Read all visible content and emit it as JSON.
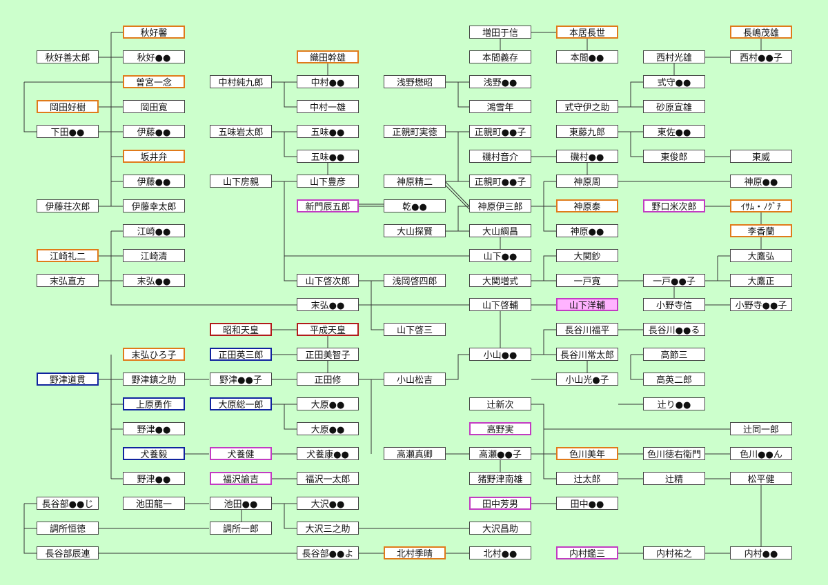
{
  "nodes": [
    {
      "id": "n1",
      "label": "秋好馨",
      "style": "orange"
    },
    {
      "id": "n2",
      "label": "秋好善太郎"
    },
    {
      "id": "n3",
      "label": "秋好●●"
    },
    {
      "id": "n4",
      "label": "曽宮一念",
      "style": "orange"
    },
    {
      "id": "n5",
      "label": "岡田好樹",
      "style": "orange"
    },
    {
      "id": "n6",
      "label": "岡田寛"
    },
    {
      "id": "n7",
      "label": "下田●●"
    },
    {
      "id": "n8",
      "label": "伊藤●●"
    },
    {
      "id": "n9",
      "label": "坂井弁",
      "style": "orange"
    },
    {
      "id": "n10",
      "label": "伊藤●●"
    },
    {
      "id": "n11",
      "label": "伊藤荘次郎"
    },
    {
      "id": "n12",
      "label": "伊藤幸太郎"
    },
    {
      "id": "n13",
      "label": "江崎●●"
    },
    {
      "id": "n14",
      "label": "江崎礼二",
      "style": "orange"
    },
    {
      "id": "n15",
      "label": "江崎清"
    },
    {
      "id": "n16",
      "label": "末弘直方"
    },
    {
      "id": "n17",
      "label": "末弘●●"
    },
    {
      "id": "n18",
      "label": "末弘ひろ子",
      "style": "orange"
    },
    {
      "id": "n19",
      "label": "野津道貫",
      "style": "navy"
    },
    {
      "id": "n20",
      "label": "野津鎮之助"
    },
    {
      "id": "n21",
      "label": "上原勇作",
      "style": "navy"
    },
    {
      "id": "n22",
      "label": "野津●●"
    },
    {
      "id": "n23",
      "label": "犬養毅",
      "style": "navy"
    },
    {
      "id": "n24",
      "label": "野津●●"
    },
    {
      "id": "n25",
      "label": "長谷部●●じ"
    },
    {
      "id": "n26",
      "label": "調所恒徳"
    },
    {
      "id": "n27",
      "label": "長谷部辰連"
    },
    {
      "id": "n28",
      "label": "池田龍一"
    },
    {
      "id": "n29",
      "label": "中村純九郎"
    },
    {
      "id": "n30",
      "label": "五味岩太郎"
    },
    {
      "id": "n31",
      "label": "山下房親"
    },
    {
      "id": "n32",
      "label": "昭和天皇",
      "style": "crimson"
    },
    {
      "id": "n33",
      "label": "正田英三郎",
      "style": "navy"
    },
    {
      "id": "n34",
      "label": "野津●●子"
    },
    {
      "id": "n35",
      "label": "大原総一郎",
      "style": "navy"
    },
    {
      "id": "n36",
      "label": "犬養健",
      "style": "magenta"
    },
    {
      "id": "n37",
      "label": "福沢諭吉",
      "style": "magenta"
    },
    {
      "id": "n38",
      "label": "池田●●"
    },
    {
      "id": "n39",
      "label": "調所一郎"
    },
    {
      "id": "n40",
      "label": "織田幹雄",
      "style": "orange"
    },
    {
      "id": "n41",
      "label": "中村●●"
    },
    {
      "id": "n42",
      "label": "中村一雄"
    },
    {
      "id": "n43",
      "label": "五味●●"
    },
    {
      "id": "n44",
      "label": "五味●●"
    },
    {
      "id": "n45",
      "label": "山下豊彦"
    },
    {
      "id": "n46",
      "label": "新門辰五郎",
      "style": "magenta"
    },
    {
      "id": "n47",
      "label": "山下啓次郎"
    },
    {
      "id": "n48",
      "label": "末弘●●"
    },
    {
      "id": "n49",
      "label": "平成天皇",
      "style": "crimson"
    },
    {
      "id": "n50",
      "label": "正田美智子"
    },
    {
      "id": "n51",
      "label": "正田修"
    },
    {
      "id": "n52",
      "label": "大原●●"
    },
    {
      "id": "n53",
      "label": "大原●●"
    },
    {
      "id": "n54",
      "label": "犬養康●●"
    },
    {
      "id": "n55",
      "label": "福沢一太郎"
    },
    {
      "id": "n56",
      "label": "大沢●●"
    },
    {
      "id": "n57",
      "label": "大沢三之助"
    },
    {
      "id": "n58",
      "label": "長谷部●●よ"
    },
    {
      "id": "n59",
      "label": "浅野懋昭"
    },
    {
      "id": "n60",
      "label": "正親町実徳"
    },
    {
      "id": "n61",
      "label": "神原精二"
    },
    {
      "id": "n62",
      "label": "乾●●"
    },
    {
      "id": "n63",
      "label": "大山探賢"
    },
    {
      "id": "n64",
      "label": "浅岡啓四郎"
    },
    {
      "id": "n65",
      "label": "山下啓三"
    },
    {
      "id": "n66",
      "label": "小山松吉"
    },
    {
      "id": "n67",
      "label": "高瀬真卿"
    },
    {
      "id": "n68",
      "label": "北村季晴",
      "style": "orange"
    },
    {
      "id": "n69",
      "label": "増田于信"
    },
    {
      "id": "n70",
      "label": "本間義存"
    },
    {
      "id": "n71",
      "label": "浅野●●"
    },
    {
      "id": "n72",
      "label": "鴻雪年"
    },
    {
      "id": "n73",
      "label": "正親町●●子"
    },
    {
      "id": "n74",
      "label": "磯村音介"
    },
    {
      "id": "n75",
      "label": "正親町●●子"
    },
    {
      "id": "n76",
      "label": "神原伊三郎"
    },
    {
      "id": "n77",
      "label": "大山綱昌"
    },
    {
      "id": "n78",
      "label": "山下●●"
    },
    {
      "id": "n79",
      "label": "大関増式"
    },
    {
      "id": "n80",
      "label": "山下啓輔"
    },
    {
      "id": "n81",
      "label": "小山●●"
    },
    {
      "id": "n82",
      "label": "辻新次"
    },
    {
      "id": "n83",
      "label": "高野実",
      "style": "magenta"
    },
    {
      "id": "n84",
      "label": "高瀬●●子"
    },
    {
      "id": "n85",
      "label": "猪野津南雄"
    },
    {
      "id": "n86",
      "label": "田中芳男",
      "style": "magenta"
    },
    {
      "id": "n87",
      "label": "大沢昌助"
    },
    {
      "id": "n88",
      "label": "北村●●"
    },
    {
      "id": "n89",
      "label": "本居長世",
      "style": "orange"
    },
    {
      "id": "n90",
      "label": "本間●●"
    },
    {
      "id": "n91",
      "label": "式守伊之助"
    },
    {
      "id": "n92",
      "label": "東藤九郎"
    },
    {
      "id": "n93",
      "label": "磯村●●"
    },
    {
      "id": "n94",
      "label": "神原周"
    },
    {
      "id": "n95",
      "label": "神原泰",
      "style": "orange"
    },
    {
      "id": "n96",
      "label": "神原●●"
    },
    {
      "id": "n97",
      "label": "大関鈔"
    },
    {
      "id": "n98",
      "label": "一戸寛"
    },
    {
      "id": "n99",
      "label": "山下洋輔",
      "style": "magenta pinkfill"
    },
    {
      "id": "n100",
      "label": "長谷川福平"
    },
    {
      "id": "n101",
      "label": "長谷川常太郎"
    },
    {
      "id": "n102",
      "label": "小山光●子"
    },
    {
      "id": "n103",
      "label": "色川美年",
      "style": "orange"
    },
    {
      "id": "n104",
      "label": "辻太郎"
    },
    {
      "id": "n105",
      "label": "田中●●"
    },
    {
      "id": "n106",
      "label": "内村鑑三",
      "style": "magenta"
    },
    {
      "id": "n107",
      "label": "西村光雄"
    },
    {
      "id": "n108",
      "label": "式守●●"
    },
    {
      "id": "n109",
      "label": "砂原宣雄"
    },
    {
      "id": "n110",
      "label": "東佐●●"
    },
    {
      "id": "n111",
      "label": "東俊郎"
    },
    {
      "id": "n112",
      "label": "野口米次郎",
      "style": "magenta"
    },
    {
      "id": "n113",
      "label": "一戸●●子"
    },
    {
      "id": "n114",
      "label": "小野寺信"
    },
    {
      "id": "n115",
      "label": "長谷川●●る"
    },
    {
      "id": "n116",
      "label": "高節三"
    },
    {
      "id": "n117",
      "label": "高英二郎"
    },
    {
      "id": "n118",
      "label": "辻り●●"
    },
    {
      "id": "n119",
      "label": "色川徳右衛門"
    },
    {
      "id": "n120",
      "label": "辻精"
    },
    {
      "id": "n121",
      "label": "内村祐之"
    },
    {
      "id": "n122",
      "label": "長嶋茂雄",
      "style": "orange"
    },
    {
      "id": "n123",
      "label": "西村●●子"
    },
    {
      "id": "n124",
      "label": "東威"
    },
    {
      "id": "n125",
      "label": "神原●●"
    },
    {
      "id": "n126",
      "label": "ｲｻﾑ・ﾉｸﾞﾁ",
      "style": "orange"
    },
    {
      "id": "n127",
      "label": "李香蘭",
      "style": "orange"
    },
    {
      "id": "n128",
      "label": "大鷹弘"
    },
    {
      "id": "n129",
      "label": "大鷹正"
    },
    {
      "id": "n130",
      "label": "小野寺●●子"
    },
    {
      "id": "n131",
      "label": "辻同一郎"
    },
    {
      "id": "n132",
      "label": "色川●●ん"
    },
    {
      "id": "n133",
      "label": "松平健"
    },
    {
      "id": "n134",
      "label": "内村●●"
    }
  ]
}
